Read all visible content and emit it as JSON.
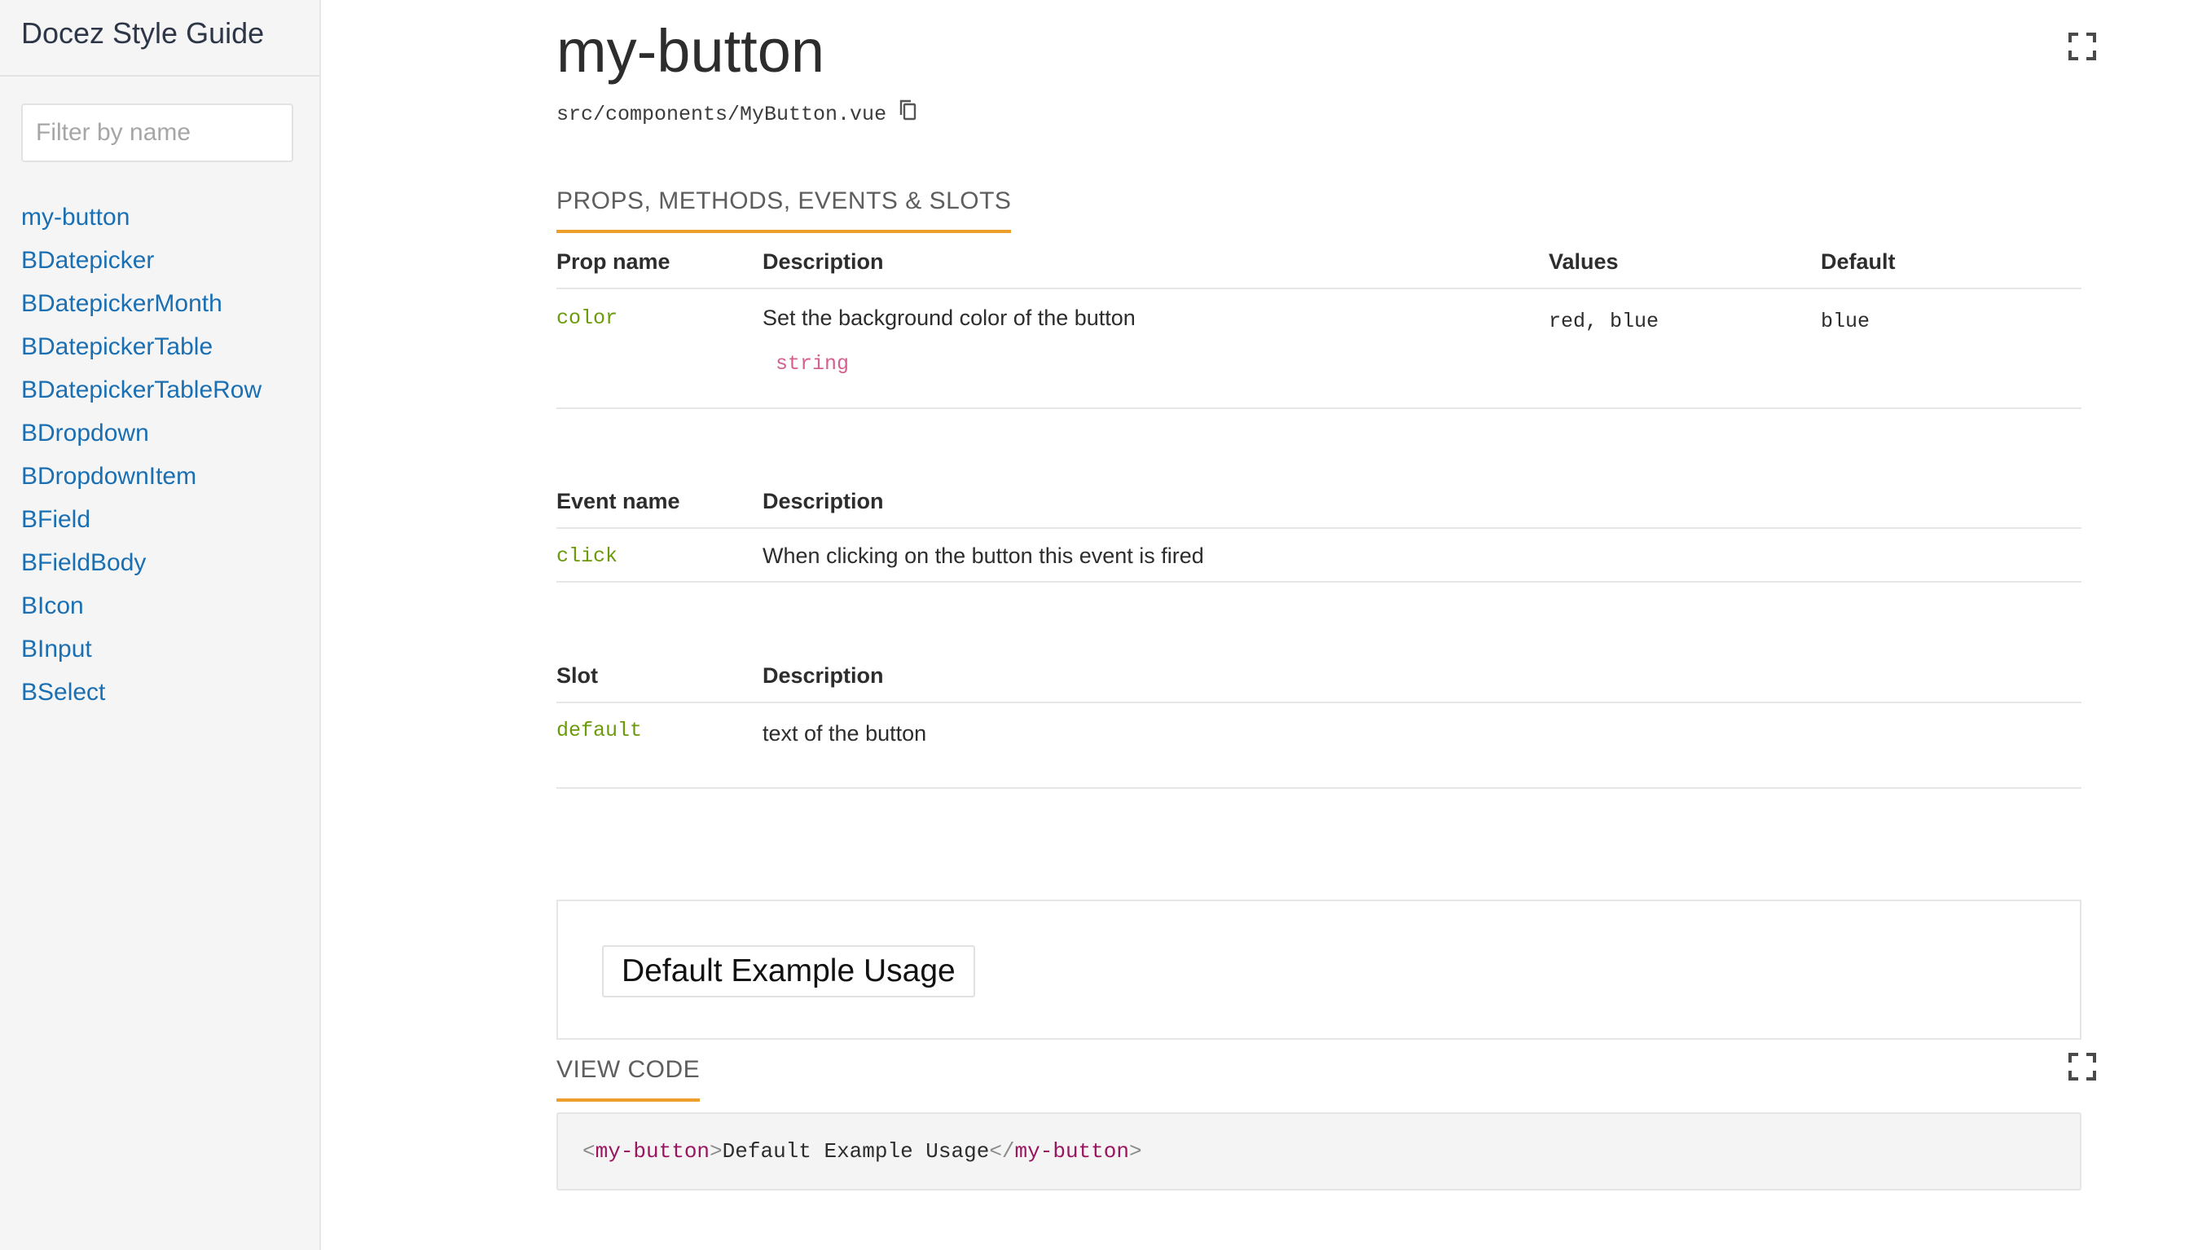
{
  "sidebar": {
    "brand": "Docez Style Guide",
    "filter_placeholder": "Filter by name",
    "items": [
      {
        "label": "my-button"
      },
      {
        "label": "BDatepicker"
      },
      {
        "label": "BDatepickerMonth"
      },
      {
        "label": "BDatepickerTable"
      },
      {
        "label": "BDatepickerTableRow"
      },
      {
        "label": "BDropdown"
      },
      {
        "label": "BDropdownItem"
      },
      {
        "label": "BField"
      },
      {
        "label": "BFieldBody"
      },
      {
        "label": "BIcon"
      },
      {
        "label": "BInput"
      },
      {
        "label": "BSelect"
      }
    ]
  },
  "main": {
    "title": "my-button",
    "path": "src/components/MyButton.vue",
    "tab_props": "PROPS, METHODS, EVENTS & SLOTS",
    "props": {
      "headers": {
        "name": "Prop name",
        "description": "Description",
        "values": "Values",
        "default": "Default"
      },
      "rows": [
        {
          "name": "color",
          "description": "Set the background color of the button",
          "type": "string",
          "values": "red, blue",
          "default": "blue"
        }
      ]
    },
    "events": {
      "headers": {
        "name": "Event name",
        "description": "Description"
      },
      "rows": [
        {
          "name": "click",
          "description": "When clicking on the button this event is fired"
        }
      ]
    },
    "slots": {
      "headers": {
        "name": "Slot",
        "description": "Description"
      },
      "rows": [
        {
          "name": "default",
          "description": "text of the button"
        }
      ]
    },
    "example": {
      "button_label": "Default Example Usage",
      "tab_code": "VIEW CODE",
      "code": {
        "open_lt": "<",
        "tag_open": "my-button",
        "open_gt": ">",
        "content": "Default Example Usage",
        "close_lt": "</",
        "tag_close": "my-button",
        "close_gt": ">"
      }
    }
  },
  "icons": {
    "expand": "expand-icon",
    "copy": "copy-icon"
  },
  "colors": {
    "link": "#1a6fb3",
    "accent": "#ec9f2a",
    "code_name": "#6b9a0a",
    "type": "#d3608e",
    "code_tag": "#99155f"
  }
}
